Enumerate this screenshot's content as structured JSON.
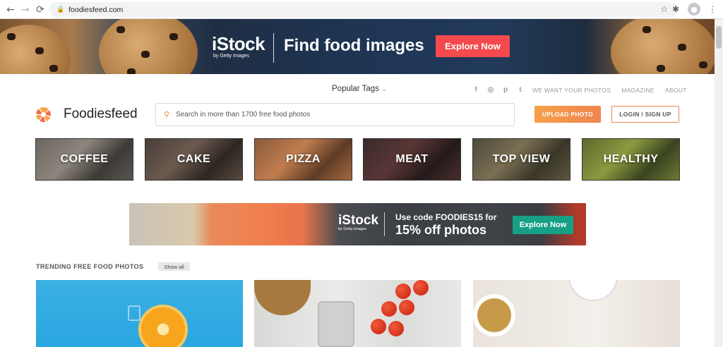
{
  "browser": {
    "url": "foodiesfeed.com",
    "back_icon": "←",
    "forward_icon": "→",
    "reload_icon": "⟳",
    "lock_icon": "🔒",
    "star_icon": "☆",
    "extensions_icon": "✱",
    "profile_icon": "●",
    "menu_icon": "⋮"
  },
  "top_banner": {
    "brand": "iStock",
    "brand_sub": "by Getty Images",
    "headline": "Find food images",
    "cta": "Explore Now",
    "cta_color": "#f4494d"
  },
  "header": {
    "popular_tags": "Popular Tags",
    "popular_tags_chevron": "⌄",
    "socials": [
      "f",
      "◎",
      "p",
      "t"
    ],
    "links": [
      "WE WANT YOUR PHOTOS",
      "MAGAZINE",
      "ABOUT"
    ],
    "logo_text": "Foodiesfeed",
    "search_icon": "⚲",
    "search_placeholder": "Search in more than 1700 free food photos",
    "upload_label": "UPLOAD PHOTO",
    "login_label": "LOGIN / SIGN UP",
    "accent": "#f08450"
  },
  "categories": [
    {
      "label": "COFFEE"
    },
    {
      "label": "CAKE"
    },
    {
      "label": "PIZZA"
    },
    {
      "label": "MEAT"
    },
    {
      "label": "TOP VIEW"
    },
    {
      "label": "HEALTHY"
    }
  ],
  "mid_banner": {
    "brand": "iStock",
    "brand_sub": "by Getty Images",
    "line1": "Use code FOODIES15 for",
    "line2": "15% off photos",
    "cta": "Explore Now",
    "cta_color": "#16a085"
  },
  "trending": {
    "title": "TRENDING FREE FOOD PHOTOS",
    "show_all": "Show all"
  }
}
